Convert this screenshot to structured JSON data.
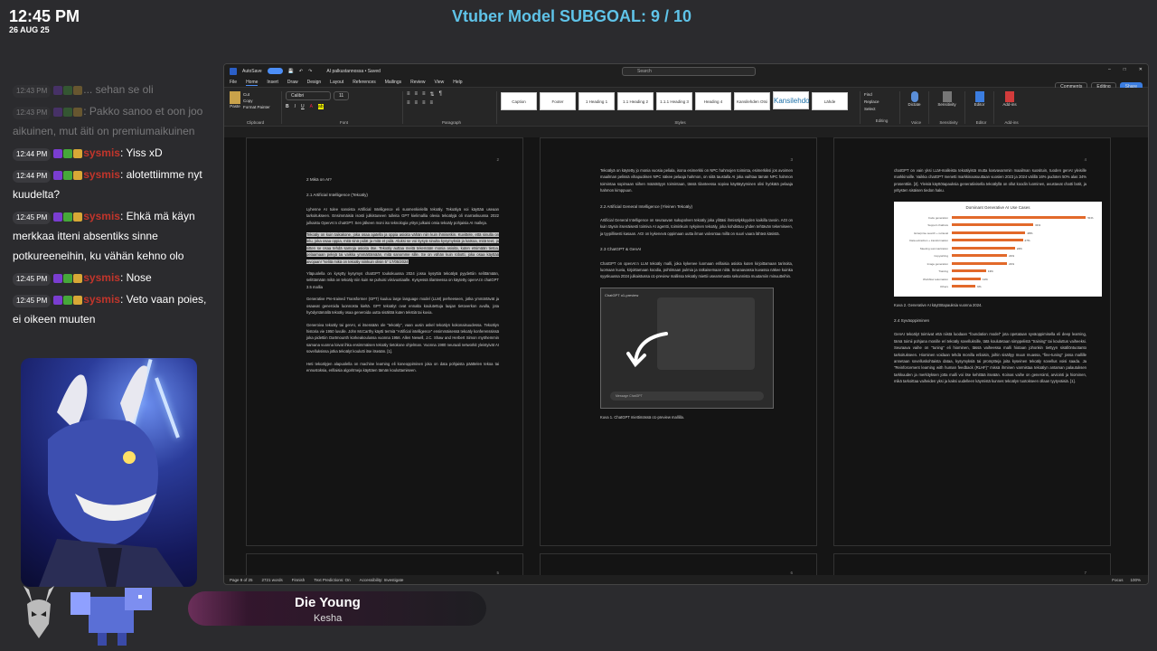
{
  "overlay": {
    "clock": "12:45 PM",
    "date": "26 AUG 25",
    "subgoal": "Vtuber Model SUBGOAL: 9 / 10"
  },
  "chat": [
    {
      "time": "12:43 PM",
      "user": "",
      "text": "... sehan se oli",
      "faded": true
    },
    {
      "time": "12:43 PM",
      "user": "",
      "text": ": Pakko sanoo et oon joo aikuinen, mut äiti on premiumaikuinen",
      "faded": true
    },
    {
      "time": "12:44 PM",
      "user": "sysmis",
      "text": ": Yiss xD"
    },
    {
      "time": "12:44 PM",
      "user": "sysmis",
      "text": ": alotettiimme nyt kuudelta?"
    },
    {
      "time": "12:45 PM",
      "user": "sysmis",
      "text": ": Ehkä mä käyn merkkaa itteni absentiks sinne potkureeneihin, ku vähän kehno olo"
    },
    {
      "time": "12:45 PM",
      "user": "sysmis",
      "text": ": Nose"
    },
    {
      "time": "12:45 PM",
      "user": "sysmis",
      "text": ": Veto vaan poies, ei oikeen muuten"
    }
  ],
  "now_playing": {
    "title": "Die Young",
    "artist": "Kesha"
  },
  "word": {
    "autosave": "AutoSave",
    "doc_title": "AI palkustannossa • Saved",
    "search_placeholder": "Search",
    "menu": [
      "File",
      "Home",
      "Insert",
      "Draw",
      "Design",
      "Layout",
      "References",
      "Mailings",
      "Review",
      "View",
      "Help"
    ],
    "right_buttons": [
      "Comments",
      "Editing",
      "Share"
    ],
    "font": "Calibri",
    "font_size": "11",
    "clipboard_items": [
      "Paste",
      "Cut",
      "Copy",
      "Format Painter"
    ],
    "group_labels": [
      "Clipboard",
      "Font",
      "Paragraph",
      "Styles",
      "Editing",
      "Voice",
      "Sensitivity",
      "Editor",
      "Add-ins"
    ],
    "styles": [
      "Caption",
      "Footer",
      "1 Heading 1",
      "1.1 Heading 2",
      "1.1.1 Heading 3",
      "Heading 4",
      "Kansilehden Otsi",
      "Kansilehdo",
      "Lähde"
    ],
    "editing": [
      "Find",
      "Replace",
      "Select"
    ],
    "voice": "Dictate",
    "sensitivity": "Sensitivity",
    "editor": "Editor",
    "addins": "Add-ins",
    "status": [
      "Page 9 of 25",
      "2721 words",
      "Finnish",
      "Text Predictions: On",
      "Accessibility: Investigate"
    ],
    "status_right": [
      "Focus",
      "100%"
    ],
    "pages": [
      {
        "num": "2",
        "blocks": [
          {
            "h": "2    Mikä on AI?"
          },
          {
            "h": "2.1    Artificial Intelligence (Tekoäly)"
          },
          {
            "p": "Lyhenne AI tulee sanoista Artificial Intelligence eli suomenkielellä tekoäly. Tekoälyä voi käyttää useaan tarkoitukseen. Ensimmäisiä isosti julkistuneen tulleita GPT kielimallia olevia tekoälyjä oli marraskuussa 2022 julkaistu OpenAI:n chatGPT. Sen jälkeen moni iso teknologia yritys julkaisi omia tekoäly pohjaisia AI malleja."
          },
          {
            "p": "Tekoäly on kuin taikakone, joka osaa ajatella ja oppia asioita vähän niin kuin ihmisetkin. Kuvittele, että sinulla on lelu, joka osaa oppia, mitä sinä pidät ja mitä et pidä. Aluksi se voi kysyä sinulta kysymyksiä ja katsoa, mitä teet, ja sitten se osaa tehdä samoja asioita itse. Tekoäly auttaa meitä tekemään monia asioita, kuten etsimään tietoa, pelaamaan pelejä tai vaikka ymmärtämään, mitä sanomme sille. Se on vähän kuin robotti, joka osaa käyttää aivojaan! \"selitä mikä on tekoäly niinkuin olisin 5\" 17/05/2024",
            "hl": true
          },
          {
            "p": "Yläpuolella on kysytty kysymys chatGPT toukokuussa 2024 jossa kysyttiä tekoälyä pyydettiin selittämään, selittämään mikä on tekoäly niin kuin se puhuisi viisivuotiaalle. Kysyessä tilanteessa on käytetty openAI:n chatGPT 3.5 mallia"
          },
          {
            "p": "Generative Pre-trained Transformer (GPT) kuuluu large language model (LLM) perheeseen, jotka ymmärtävät ja osaavat generoida luonnosta kieltä. GPT tekoälyt ovat ennalta koulutettuja laajan tietoverkon avulla, jota hyödyntämällä tekoäly osaa generoida uutta sisältöä kuten tekstiä tai kuvia."
          },
          {
            "p": "Generoiva tekoäly tai genAI, ei itsessään ole \"tekoäly\", vaan uusin askel tekoälyn kokonaisuudessa. Tekoälyn historia vie 1950 luvulle. John McCarthy käytti termiä \"Artificial intelligence\" ensimmäisessä tekoäly konferenssissä joka pidettiin Dartmounth korkeakoulussa vuonna 1956. Allen Newell, J.C. Shaw and Herbert Simon myöhemmin samana vuonna loivat ihka ensimmäisen tekoäly tietokone ohjelman. Vuonna 1980 neuraali networkit yleistyivät AI sovelluksissa jotka tekoälyt koulutti itse itseään. [1]."
          },
          {
            "p": "Heti tekoälyjen alapuolella on machine learning eli koneoppiminen joka on data pohjaista päättelen tekoa tai ennustoksia, erillaisia algoritmeja käyttäen tämän kouluttamiseen."
          }
        ]
      },
      {
        "num": "3",
        "blocks": [
          {
            "p": "Tekoälyä on käytetty jo monia vuosia peliala, isona esimerkki on NPC hahmojen toiminta, esimerkiksi jos avoimen maailman pelissä vihapuolisen NPC näkee pelaaja hahmon, on siitä taustalla AI joka vaihtaa tämän NPC hahmon toimintaa sopimaan siihen määrättyyn toimintaan, tässä tilanteessa sopiva käyttäytyminen olisi hyökätä pelaaja hahmon kimppuun."
          },
          {
            "h": "2.2    Artificial General Intelligence (Yleinen Tekoäly)"
          },
          {
            "p": "Artificial General Intelligence on seuraavan sukupolven tekoäly joka ylittäsi ihmisälykkyyden kaikilla tavoin. AGI on kuin täysin itsenäisesti toimiva AI agentti, toiminkuin nykyinen tekoäly, joka kohdistuu yhden tehtävän tekemiseen, ja tyypillisesti kasaan. AGI on kykenevä oppimaan uutta ilman valvontaa millä on suuri vaara lähteä käsistä."
          },
          {
            "h": "2.3    ChatGPT & GenAI"
          },
          {
            "p": "ChatGPT on openAI:n LLM tekoäly malli, joka kykenee luomaan erillaisia asioita kuten kirjoittamaan tarinoita, luomaan kuvia, kirjoittamaan koodia, pohtimaan pulmia ja ratkaisemaan niitä. Seuraavassa kuvassa näkee kuinka syyskuussa 2024 julkaistussa o1-preview mallissa tekoäly miettii useammasta sekunnista muutamiin minuutteihin."
          },
          {
            "shot": true,
            "shot_title": "ChatGPT o1-preview",
            "shot_input": "Message ChatGPT"
          },
          {
            "p": "Kuva 1. ChatGPT miettimässä o1-preview mallilla."
          }
        ]
      },
      {
        "num": "4",
        "blocks": [
          {
            "p": "chatGPT on vain yksi LLM-malleista tekoälyistä mutta kasvavammin maailman suosituin, tuoden genAI yleisille markkinoille. Vaikka chatGPT menetti markkinaosuuttaan vuosien 2023 ja 2024 välillä 16% pudoten 50% alas 34% prosenttiin. [2]. Yleisiä käyttötapauksia generatiivisella tekoälyllä on ollut koodin luominen, avustavat chatti botit, ja yritysten sisäisen tiedon haku."
          },
          {
            "chart": true
          },
          {
            "p": "Kuva 2. Generative AI käyttötapauksia vuonna 2024."
          },
          {
            "h": "2.4    Syväoppiminen"
          },
          {
            "p": "GenAI tekoälyt toimivat että niistä luodaan \"foundation model\" jota opetataan syväoppimisella eli deep learning, tämä toimii pohjana monille eri tekoäly sovelluksille, tätä koulutetaan simppelistä \"training\" tai kouluttus vaiheeksi. Seuraava vaihe on \"tuning\" eli hiominen, tässä vaiheessa malli hiotaan johonkin tiettyyn sisällöntuotanto tarkoitukseen. Hiominen voidaan tehdä monilla erilaisin, joihin sisältyy muun muassa, \"fine-tuning\" jossa mallille annetaan sovelluskohtaista dataa, kysymyksiä tai promptteja joita kyseinen tekoäly sovellus voisi saada. Ja \"Reinforcement learning with human feedback (RLHF)\" missä ihminen varmistaa tekoälyn antaman palautuksen tarkkuuden ja merkityksen jotta malli voi itse kehittää itseään. Koinas vaihe on generointi, arviointi ja hiominen, mikä tarkoittaa vaiheiden yksi ja kaksi uudelleen käymistä kunnes tekoälyn tuotokseen ollaan tyytyväisiä. [1]."
          }
        ]
      }
    ],
    "thumb_nums": [
      "5",
      "6",
      "7"
    ]
  },
  "chart_data": {
    "type": "bar",
    "title": "Dominant Generative AI Use Cases",
    "categories": [
      "Code generation",
      "Support chatbots",
      "Enterprise search + retrieval",
      "Data extraction + transformation",
      "Meeting summarization",
      "Copywriting",
      "Image generation",
      "Training",
      "Workflow automation",
      "Others"
    ],
    "values": [
      51,
      31,
      28,
      27,
      24,
      21,
      21,
      13,
      11,
      9
    ],
    "orientation": "horizontal",
    "color": "#e2692a"
  }
}
